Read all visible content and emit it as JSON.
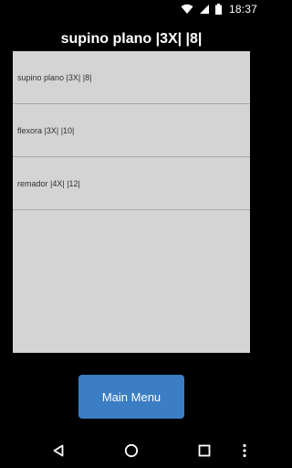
{
  "status_bar": {
    "time": "18:37",
    "icons": [
      "wifi-icon",
      "signal-icon",
      "battery-icon"
    ]
  },
  "header": {
    "title": "supino plano |3X| |8|"
  },
  "exercise_list": {
    "items": [
      {
        "label": "supino plano |3X| |8|"
      },
      {
        "label": "flexora |3X| |10|"
      },
      {
        "label": "remador |4X| |12|"
      }
    ]
  },
  "main_menu_button": {
    "label": "Main Menu",
    "color": "#3b7ec4"
  },
  "nav_bar": {
    "buttons": [
      "back-icon",
      "home-icon",
      "recents-icon",
      "more-icon"
    ]
  },
  "colors": {
    "background": "#000000",
    "panel": "#d4d4d4",
    "divider": "#a8a8a8",
    "accent": "#3b7ec4"
  }
}
